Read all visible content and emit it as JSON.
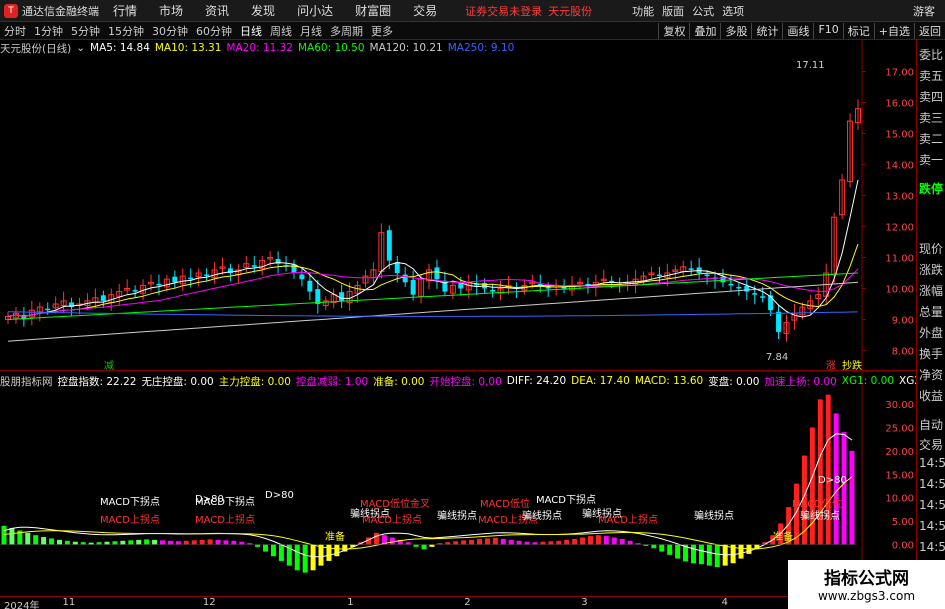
{
  "titlebar": {
    "app_title": "通达信金融终端",
    "menus": [
      "行情",
      "市场",
      "资讯",
      "发现",
      "问小达",
      "财富圈",
      "交易"
    ],
    "warning": "证券交易未登录",
    "stock_name": "天元股份",
    "right_menus": [
      "功能",
      "版面",
      "公式",
      "选项"
    ],
    "guest": "游客"
  },
  "periods": [
    "分时",
    "1分钟",
    "5分钟",
    "15分钟",
    "30分钟",
    "60分钟",
    "日线",
    "周线",
    "月线",
    "多周期",
    "更多"
  ],
  "active_period": "日线",
  "toolbar_buttons": [
    "复权",
    "叠加",
    "多股",
    "统计",
    "画线",
    "F10",
    "标记",
    "+自选",
    "返回"
  ],
  "main_header": {
    "stock": "天元股份(日线)",
    "ma": [
      {
        "label": "MA5: 14.84",
        "color": "#ffffff"
      },
      {
        "label": "MA10: 13.31",
        "color": "#ffff00"
      },
      {
        "label": "MA20: 11.32",
        "color": "#ff00ff"
      },
      {
        "label": "MA60: 10.50",
        "color": "#00ff00"
      },
      {
        "label": "MA120: 10.21",
        "color": "#cccccc"
      },
      {
        "label": "MA250: 9.10",
        "color": "#3366ff"
      }
    ]
  },
  "indicator_header": [
    {
      "label": "股朋指标网",
      "color": "#cccccc"
    },
    {
      "label": "控盘指数: 22.22",
      "color": "#ffffff"
    },
    {
      "label": "无庄控盘: 0.00",
      "color": "#ffffff"
    },
    {
      "label": "主力控盘: 0.00",
      "color": "#ffff00"
    },
    {
      "label": "控盘减弱: 1.00",
      "color": "#ff00ff"
    },
    {
      "label": "准备: 0.00",
      "color": "#ffff00"
    },
    {
      "label": "开始控盘: 0.00",
      "color": "#ff00ff"
    },
    {
      "label": "DIFF: 24.20",
      "color": "#ffffff"
    },
    {
      "label": "DEA: 17.40",
      "color": "#ffff00"
    },
    {
      "label": "MACD: 13.60",
      "color": "#ffff00"
    },
    {
      "label": "变盘: 0.00",
      "color": "#ffffff"
    },
    {
      "label": "加速上扬: 0.00",
      "color": "#ff00ff"
    },
    {
      "label": "XG1: 0.00",
      "color": "#00ff00"
    },
    {
      "label": "XG2: 0.00",
      "color": "#ffffff"
    },
    {
      "label": "绿柱短",
      "color": "#ff00ff"
    }
  ],
  "price_axis": [
    "17.00",
    "16.00",
    "15.00",
    "14.00",
    "13.00",
    "12.00",
    "11.00",
    "10.00",
    "9.00",
    "8.00"
  ],
  "ind_axis": [
    "30.00",
    "25.00",
    "20.00",
    "15.00",
    "10.00",
    "5.00",
    "0.00"
  ],
  "price_labels": {
    "high": "17.11",
    "low": "7.84",
    "bottom_left": "减",
    "bottom_right_1": "涨",
    "bottom_right_2": "抄跌"
  },
  "x_axis": [
    {
      "label": "2024年",
      "pos": 0.0
    },
    {
      "label": "11",
      "pos": 0.075
    },
    {
      "label": "12",
      "pos": 0.255
    },
    {
      "label": "1",
      "pos": 0.44
    },
    {
      "label": "2",
      "pos": 0.59
    },
    {
      "label": "3",
      "pos": 0.74
    },
    {
      "label": "4",
      "pos": 0.92
    }
  ],
  "side_panel": [
    "委比",
    "卖五",
    "卖四",
    "卖三",
    "卖二",
    "卖一",
    "",
    "跌停",
    "",
    "现价",
    "涨跌",
    "涨幅",
    "总量",
    "外盘",
    "换手",
    "净资",
    "收益",
    "自动",
    "交易",
    "14:56",
    "14:56",
    "14:56",
    "14:56",
    "14:56",
    "14:56",
    "14:56"
  ],
  "annotations": {
    "macd_down": "MACD下拐点",
    "macd_up": "MACD上拐点",
    "macd_low": "MACD低位金叉",
    "macd_low2": "MACD低位",
    "d80": "D>80",
    "piano": "骗线拐点",
    "ready": "准备"
  },
  "badge": {
    "line1": "指标公式网",
    "line2": "www.zbgs3.com"
  },
  "chart_data": {
    "type": "candlestick",
    "ylim": [
      7.5,
      17.5
    ],
    "closes": [
      9.1,
      9.2,
      9.0,
      9.3,
      9.4,
      9.3,
      9.5,
      9.6,
      9.4,
      9.5,
      9.6,
      9.7,
      9.6,
      9.8,
      9.9,
      10.0,
      9.9,
      10.1,
      10.2,
      10.1,
      10.3,
      10.2,
      10.4,
      10.3,
      10.5,
      10.4,
      10.6,
      10.7,
      10.5,
      10.6,
      10.8,
      10.7,
      10.9,
      11.0,
      10.8,
      10.7,
      10.5,
      10.3,
      9.9,
      9.5,
      9.6,
      9.8,
      9.6,
      9.9,
      10.1,
      10.4,
      10.6,
      11.8,
      10.9,
      10.5,
      10.2,
      9.8,
      10.3,
      10.6,
      10.3,
      9.9,
      10.1,
      10.0,
      10.2,
      10.1,
      10.0,
      9.9,
      10.0,
      10.1,
      10.0,
      10.1,
      10.2,
      10.1,
      10.0,
      10.1,
      10.0,
      10.1,
      10.2,
      10.1,
      10.2,
      10.3,
      10.2,
      10.1,
      10.2,
      10.3,
      10.4,
      10.5,
      10.4,
      10.5,
      10.6,
      10.7,
      10.6,
      10.5,
      10.4,
      10.3,
      10.2,
      10.1,
      10.0,
      9.9,
      9.8,
      9.7,
      9.3,
      8.6,
      8.9,
      9.2,
      9.4,
      9.6,
      9.8,
      10.5,
      12.3,
      13.5,
      15.4,
      15.8
    ],
    "series": [
      {
        "name": "MA5",
        "color": "#ffffff"
      },
      {
        "name": "MA10",
        "color": "#ffff00"
      },
      {
        "name": "MA20",
        "color": "#ff00ff"
      },
      {
        "name": "MA60",
        "color": "#00ff00"
      },
      {
        "name": "MA120",
        "color": "#cccccc"
      },
      {
        "name": "MA250",
        "color": "#3366ff"
      }
    ],
    "macd_ylim": [
      -8,
      33
    ],
    "macd": [
      4,
      3.5,
      3,
      2.5,
      2,
      1.6,
      1.3,
      1.0,
      0.8,
      0.6,
      0.5,
      0.4,
      0.5,
      0.6,
      0.7,
      0.8,
      0.9,
      1.0,
      1.1,
      1.0,
      0.9,
      0.8,
      0.7,
      0.8,
      0.9,
      1.0,
      1.1,
      1.0,
      0.9,
      0.8,
      0.6,
      0.3,
      -0.5,
      -1.5,
      -2.5,
      -3.5,
      -4.5,
      -5.5,
      -6,
      -5.5,
      -4.5,
      -3.5,
      -2.5,
      -1.5,
      -0.5,
      0.5,
      1.5,
      2.5,
      2.0,
      1.5,
      1.0,
      0.5,
      -0.5,
      -1.0,
      -0.5,
      0.3,
      0.5,
      0.7,
      0.9,
      1.0,
      1.2,
      1.3,
      1.4,
      1.2,
      1.0,
      0.8,
      0.6,
      0.5,
      0.6,
      0.7,
      0.8,
      1.0,
      1.2,
      1.5,
      1.8,
      2.0,
      1.8,
      1.5,
      1.2,
      0.8,
      0.3,
      -0.3,
      -0.8,
      -1.5,
      -2.2,
      -3.0,
      -3.6,
      -4.0,
      -4.2,
      -4.5,
      -4.8,
      -4.5,
      -4.0,
      -3.0,
      -2.0,
      -1.0,
      0.5,
      2.0,
      4.5,
      8,
      13,
      19,
      25,
      31,
      32,
      28,
      24,
      20
    ]
  }
}
